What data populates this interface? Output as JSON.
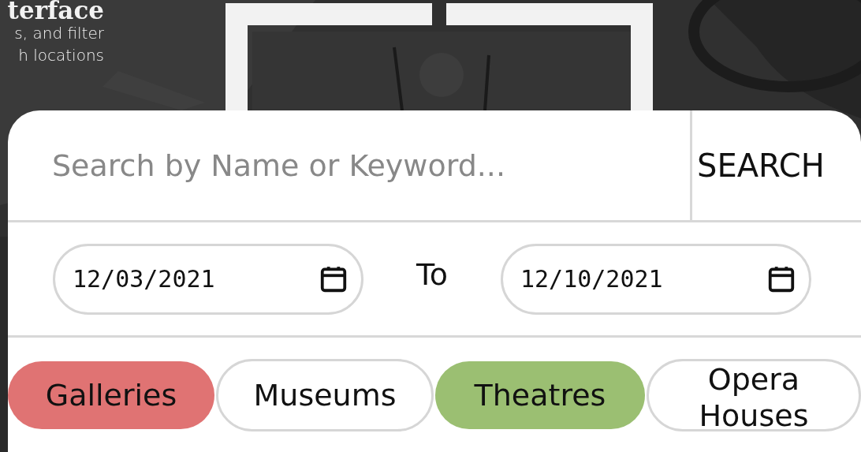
{
  "hero": {
    "title": "terface",
    "lines": [
      "s, and filter",
      "h locations"
    ]
  },
  "search": {
    "placeholder": "Search by Name or Keyword...",
    "button": "SEARCH"
  },
  "dates": {
    "from": "12/03/2021",
    "separator": "To",
    "to": "12/10/2021"
  },
  "categories": [
    {
      "label": "Galleries",
      "selected": true,
      "color": "#e07373"
    },
    {
      "label": "Museums",
      "selected": false
    },
    {
      "label": "Theatres",
      "selected": true,
      "color": "#9bbf72"
    },
    {
      "label": "Opera Houses",
      "selected": false
    }
  ]
}
